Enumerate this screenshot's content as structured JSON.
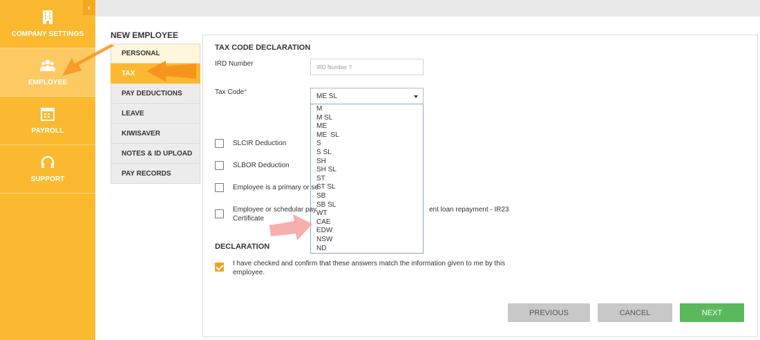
{
  "sidebar": {
    "collapse_glyph": "‹",
    "items": [
      {
        "label": "COMPANY SETTINGS",
        "icon": "building-icon"
      },
      {
        "label": "EMPLOYEE",
        "icon": "users-icon",
        "active": true
      },
      {
        "label": "PAYROLL",
        "icon": "calendar-icon"
      },
      {
        "label": "SUPPORT",
        "icon": "headset-icon"
      }
    ]
  },
  "page": {
    "title": "NEW EMPLOYEE"
  },
  "subnav": {
    "items": [
      {
        "label": "PERSONAL"
      },
      {
        "label": "TAX",
        "active": true
      },
      {
        "label": "PAY DEDUCTIONS"
      },
      {
        "label": "LEAVE"
      },
      {
        "label": "KIWISAVER"
      },
      {
        "label": "NOTES & ID UPLOAD"
      },
      {
        "label": "PAY RECORDS"
      }
    ]
  },
  "tax": {
    "heading": "TAX CODE DECLARATION",
    "ird_label": "IRD Number",
    "ird_placeholder": "IRD Number ?",
    "taxcode_label": "Tax Code",
    "required_mark": "*",
    "taxcode_value": "ME SL",
    "taxcode_options": [
      "M",
      "M SL",
      "ME",
      "ME  SL",
      "S",
      "S SL",
      "SH",
      "SH SL",
      "ST",
      "ST SL",
      "SB",
      "SB SL",
      "WT",
      "CAE",
      "EDW",
      "NSW",
      "ND"
    ],
    "checkboxes": [
      {
        "label": "SLCIR Deduction",
        "checked": false
      },
      {
        "label": "SLBOR Deduction",
        "checked": false
      },
      {
        "label": "Employee is a primary or se",
        "checked": false
      },
      {
        "label_line1": "Employee or schedular pay",
        "label_line1b": "ent loan repayment - IR23",
        "label_line2": "Certificate",
        "checked": false
      }
    ]
  },
  "declaration": {
    "heading": "DECLARATION",
    "text_line1": "I have checked and confirm that these answers match the information given to me by this",
    "text_line2": "employee.",
    "checked": true
  },
  "buttons": {
    "previous": "PREVIOUS",
    "cancel": "CANCEL",
    "next": "NEXT"
  },
  "colors": {
    "sidebar": "#fbb92f",
    "active_tab": "#fbb92f",
    "next_button": "#5cb85c",
    "annotation_arrow": "#f7941d",
    "annotation_arrow_pink": "#f6a5a5"
  }
}
